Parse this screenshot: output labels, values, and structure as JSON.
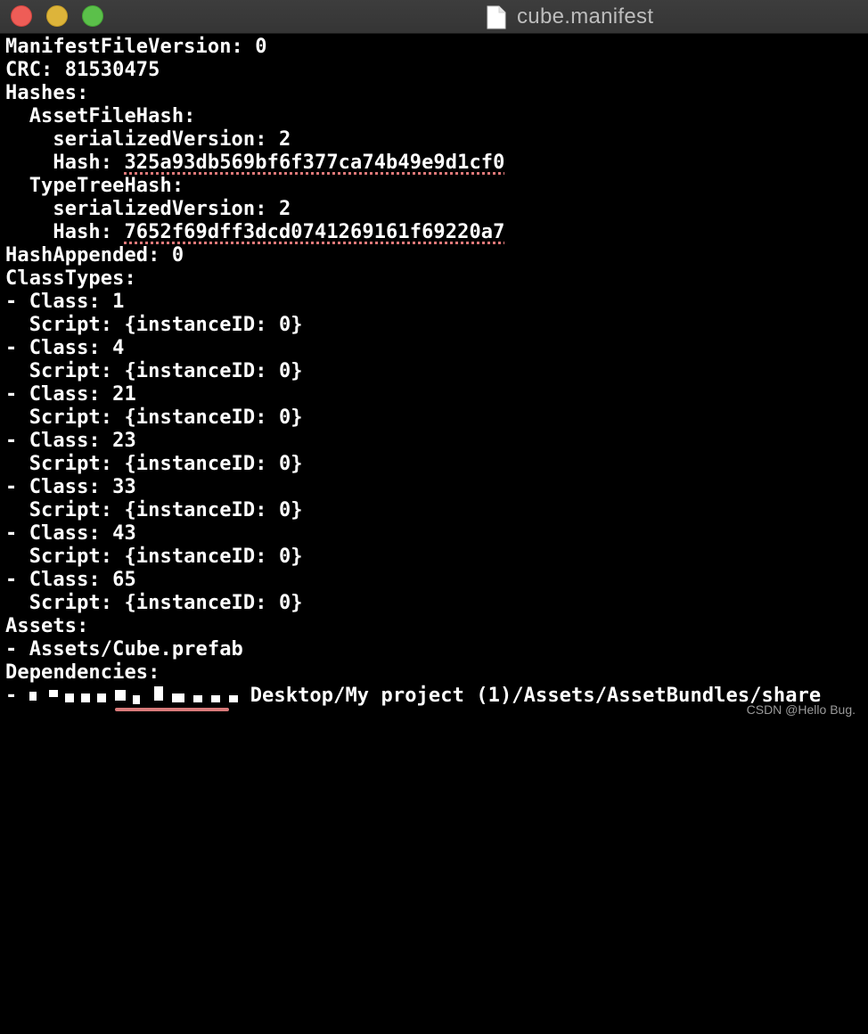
{
  "window": {
    "title": "cube.manifest",
    "file_icon": "document-icon"
  },
  "content": {
    "lines": [
      "ManifestFileVersion: 0",
      "CRC: 81530475",
      "Hashes:",
      "  AssetFileHash:",
      "    serializedVersion: 2",
      "    Hash: ",
      "  TypeTreeHash:",
      "    serializedVersion: 2",
      "    Hash: ",
      "HashAppended: 0",
      "ClassTypes:",
      "- Class: 1",
      "  Script: {instanceID: 0}",
      "- Class: 4",
      "  Script: {instanceID: 0}",
      "- Class: 21",
      "  Script: {instanceID: 0}",
      "- Class: 23",
      "  Script: {instanceID: 0}",
      "- Class: 33",
      "  Script: {instanceID: 0}",
      "- Class: 43",
      "  Script: {instanceID: 0}",
      "- Class: 65",
      "  Script: {instanceID: 0}",
      "Assets:",
      "- Assets/Cube.prefab",
      "Dependencies:",
      "- ",
      "Desktop/My project (1)/Assets/AssetBundles/share"
    ],
    "asset_file_hash": "325a93db569bf6f377ca74b49e9d1cf0",
    "type_tree_hash": "7652f69dff3dcd0741269161f69220a7"
  },
  "watermark": "CSDN @Hello Bug."
}
